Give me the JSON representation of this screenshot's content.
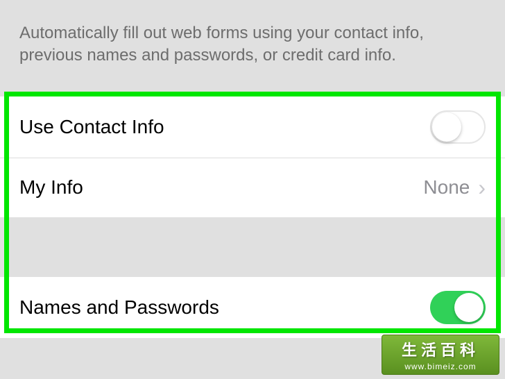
{
  "description": "Automatically fill out web forms using your contact info, previous names and passwords, or credit card info.",
  "rows": {
    "useContactInfo": {
      "label": "Use Contact Info",
      "toggled": false
    },
    "myInfo": {
      "label": "My Info",
      "value": "None"
    },
    "namesAndPasswords": {
      "label": "Names and Passwords",
      "toggled": true
    }
  },
  "watermark": {
    "title": "生活百科",
    "url": "www.bimeiz.com"
  }
}
